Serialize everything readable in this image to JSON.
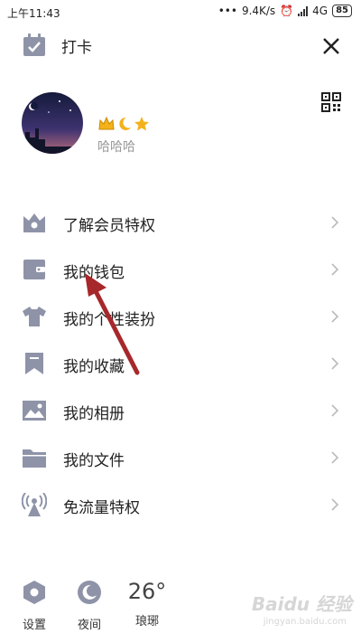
{
  "status": {
    "time": "上午11:43",
    "speed": "9.4K/s",
    "network": "4G",
    "battery": "85"
  },
  "header": {
    "checkin_label": "打卡"
  },
  "profile": {
    "username": "哈哈哈"
  },
  "menu": {
    "items": [
      {
        "label": "了解会员特权",
        "icon": "vip-crown-icon"
      },
      {
        "label": "我的钱包",
        "icon": "wallet-icon"
      },
      {
        "label": "我的个性装扮",
        "icon": "tshirt-icon"
      },
      {
        "label": "我的收藏",
        "icon": "bookmark-icon"
      },
      {
        "label": "我的相册",
        "icon": "photo-icon"
      },
      {
        "label": "我的文件",
        "icon": "folder-icon"
      },
      {
        "label": "免流量特权",
        "icon": "signal-tower-icon"
      }
    ]
  },
  "bottom": {
    "settings_label": "设置",
    "night_label": "夜间",
    "temperature": "26°",
    "city": "琅琊"
  },
  "watermark": {
    "text": "Baidu 经验",
    "sub": "jingyan.baidu.com"
  },
  "colors": {
    "icon": "#8e93a8",
    "arrow": "#a7282b"
  }
}
